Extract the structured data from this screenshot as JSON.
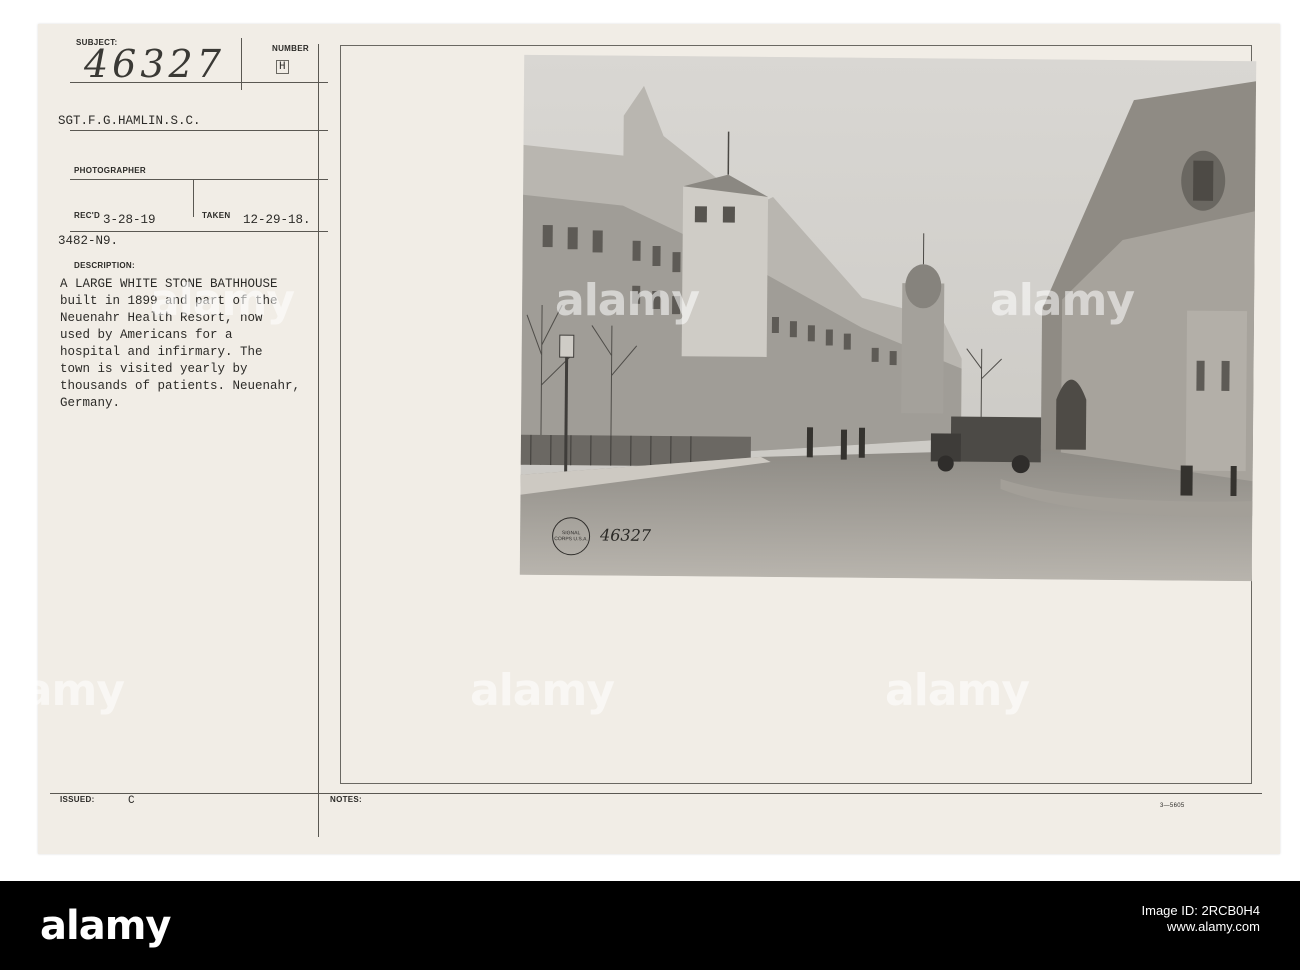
{
  "card": {
    "subject_label": "SUBJECT:",
    "subject_value": "46327",
    "number_label": "NUMBER",
    "number_value": "H",
    "photographer_name": "SGT.F.G.HAMLIN.S.C.",
    "photographer_label": "PHOTOGRAPHER",
    "recd_label": "REC'D",
    "recd_value": "3-28-19",
    "taken_label": "TAKEN",
    "taken_value": "12-29-18.",
    "ref_code": "3482-N9.",
    "description_label": "DESCRIPTION:",
    "description_lines": [
      "A LARGE WHITE STONE BATHHOUSE",
      "built in 1899 and part of the",
      "Neuenahr Health Resort, now",
      "used by Americans for a",
      "hospital and infirmary. The",
      "town is visited yearly by",
      "thousands of patients. Neuenahr,",
      "Germany."
    ],
    "issued_label": "ISSUED:",
    "issued_value": "C",
    "notes_label": "NOTES:",
    "form_number": "3—5605"
  },
  "photo": {
    "stamp_text": "SIGNAL CORPS U.S.A.",
    "handwritten_number": "46327"
  },
  "watermark": {
    "text": "alamy"
  },
  "footer": {
    "logo": "alamy",
    "image_id_line": "Image ID: 2RCB0H4",
    "url_line": "www.alamy.com"
  }
}
